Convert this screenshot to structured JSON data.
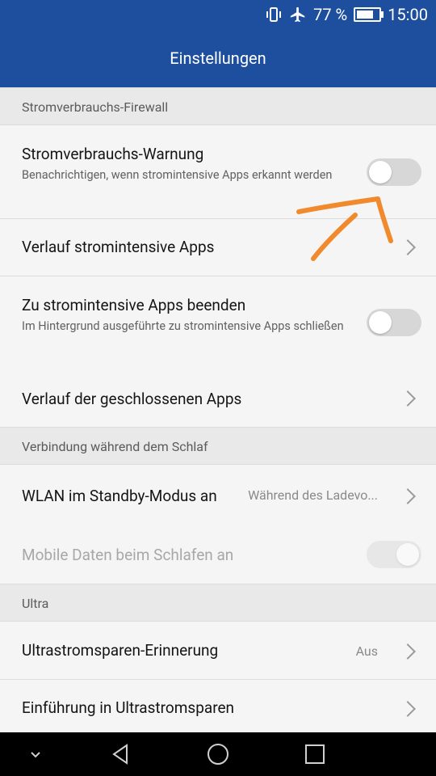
{
  "status_bar": {
    "battery_percent": "77 %",
    "battery_level": 0.77,
    "time": "15:00",
    "icons": [
      "vibrate-icon",
      "airplane-icon",
      "battery-icon"
    ]
  },
  "app_bar": {
    "title": "Einstellungen"
  },
  "sections": [
    {
      "header": "Stromverbrauchs-Firewall",
      "items": [
        {
          "title": "Stromverbrauchs-Warnung",
          "subtitle": "Benachrichtigen, wenn stromintensive Apps erkannt werden",
          "control": "switch",
          "checked": false
        },
        {
          "title": "Verlauf stromintensive Apps",
          "control": "chevron"
        },
        {
          "title": "Zu stromintensive Apps beenden",
          "subtitle": "Im Hintergrund ausgeführte zu stromintensive Apps schließen",
          "control": "switch",
          "checked": false
        },
        {
          "title": "Verlauf der geschlossenen Apps",
          "control": "chevron"
        }
      ]
    },
    {
      "header": "Verbindung während dem Schlaf",
      "items": [
        {
          "title": "WLAN im Standby-Modus an",
          "value": "Während des Ladevo...",
          "control": "chevron"
        },
        {
          "title": "Mobile Daten beim Schlafen an",
          "control": "switch",
          "checked": true,
          "disabled": true
        }
      ]
    },
    {
      "header": "Ultra",
      "items": [
        {
          "title": "Ultrastromsparen-Erinnerung",
          "value": "Aus",
          "control": "chevron"
        },
        {
          "title": "Einführung in Ultrastromsparen",
          "control": "chevron"
        }
      ]
    }
  ],
  "annotation": {
    "color": "#f08a2c",
    "icon": "hand-drawn-arrow"
  },
  "nav_bar": {
    "buttons": [
      "chevron-down-icon",
      "back-icon",
      "home-icon",
      "recents-icon"
    ]
  }
}
